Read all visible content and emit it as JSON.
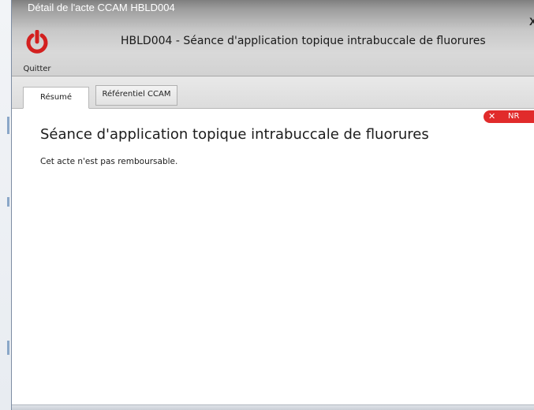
{
  "window": {
    "title": "Détail de l'acte CCAM HBLD004",
    "close_glyph": "X"
  },
  "toolbar": {
    "quit_label": "Quitter",
    "quit_icon": "power-icon",
    "header": "HBLD004 - Séance d'application topique intrabuccale de fluorures"
  },
  "tabs": [
    {
      "label": "Résumé",
      "active": true
    },
    {
      "label": "Référentiel CCAM",
      "active": false
    }
  ],
  "badge": {
    "icon": "close-icon",
    "x_glyph": "✕",
    "label": "NR",
    "color": "#e12b2b"
  },
  "content": {
    "title": "Séance d'application topique intrabuccale de fluorures",
    "note": "Cet acte n'est pas remboursable."
  },
  "colors": {
    "accent_red": "#d3201f",
    "titlebar": "#c8c8c8"
  }
}
